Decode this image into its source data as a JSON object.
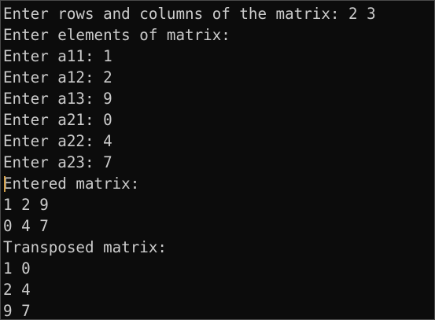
{
  "terminal": {
    "lines": [
      "Enter rows and columns of the matrix: 2 3",
      "Enter elements of matrix:",
      "Enter a11: 1",
      "Enter a12: 2",
      "Enter a13: 9",
      "Enter a21: 0",
      "Enter a22: 4",
      "Enter a23: 7",
      "Entered matrix:",
      "1 2 9",
      "0 4 7",
      "Transposed matrix:",
      "1 0",
      "2 4",
      "9 7"
    ],
    "colors": {
      "background": "#0c0c0c",
      "text": "#cccccc",
      "cursor": "#d4a04a"
    }
  }
}
